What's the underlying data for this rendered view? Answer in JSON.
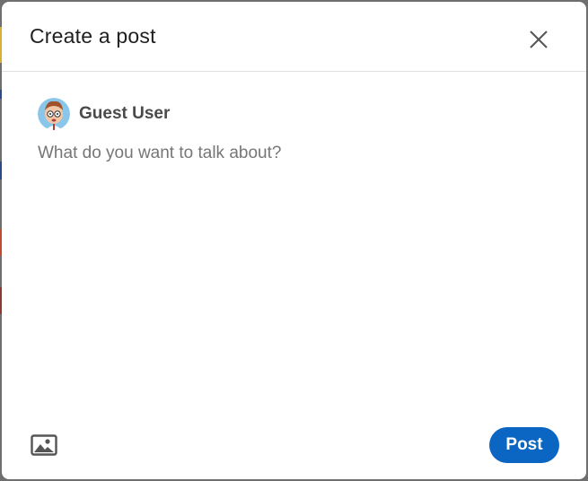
{
  "modal": {
    "title": "Create a post",
    "close_icon": "close-icon"
  },
  "author": {
    "name": "Guest User",
    "avatar_icon": "avatar-cartoon"
  },
  "composer": {
    "placeholder": "What do you want to talk about?",
    "value": ""
  },
  "footer": {
    "media_icon": "image-icon",
    "post_label": "Post"
  },
  "colors": {
    "accent": "#0a66c2",
    "backdrop": "#6f6f6f"
  }
}
